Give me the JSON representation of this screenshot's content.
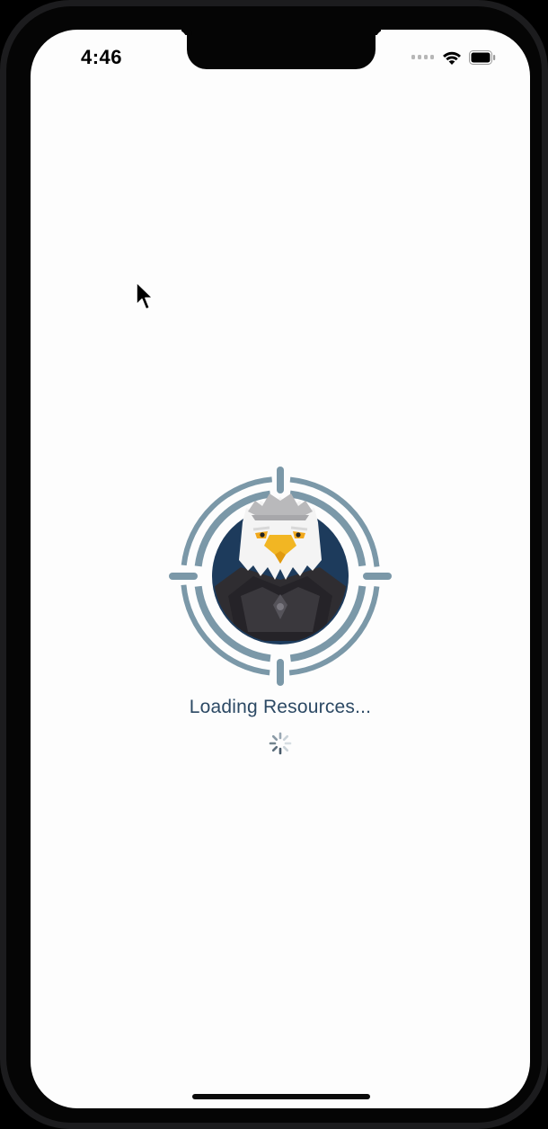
{
  "status_bar": {
    "time": "4:46",
    "icons": [
      "cellular-signal-icon",
      "wifi-icon",
      "battery-icon"
    ]
  },
  "splash": {
    "logo": "eagle-crosshair-logo",
    "loading_text": "Loading Resources...",
    "spinner": "activity-spinner-icon"
  },
  "colors": {
    "ring": "#7b98a8",
    "emblem_background": "#1d3b5c",
    "loading_text": "#2c4964",
    "screen_background": "#fdfdfd"
  }
}
